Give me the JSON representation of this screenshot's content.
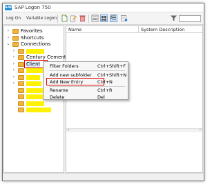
{
  "window": {
    "title": "SAP Logon 750"
  },
  "toolbar": {
    "logon_label": "Log On",
    "variable_logon_label": "Variable Logon",
    "icons": [
      "new-item-icon",
      "edit-icon",
      "delete-icon",
      "list-view-icon",
      "tile-view-icon",
      "tree-view-icon",
      "properties-icon",
      "filter-icon"
    ]
  },
  "tree": {
    "items": [
      {
        "label": "Favorites",
        "level": 0,
        "caret": "›"
      },
      {
        "label": "Shortcuts",
        "level": 0,
        "caret": "›"
      },
      {
        "label": "Connections",
        "level": 0,
        "caret": "⌄"
      },
      {
        "label": "",
        "level": 1,
        "caret": "›",
        "redacted": true
      },
      {
        "label": "Century Cement",
        "level": 1,
        "caret": "›"
      },
      {
        "label": "Client",
        "level": 1,
        "caret": "›",
        "selected": true
      },
      {
        "label": "",
        "level": 1,
        "caret": "›",
        "redacted": true
      },
      {
        "label": "",
        "level": 1,
        "caret": "›",
        "redacted": true
      },
      {
        "label": "",
        "level": 1,
        "caret": "›",
        "redacted": true
      },
      {
        "label": "",
        "level": 1,
        "caret": "",
        "redacted": true
      },
      {
        "label": "",
        "level": 1,
        "caret": "",
        "redacted": true
      },
      {
        "label": "",
        "level": 1,
        "caret": "",
        "redacted": true
      },
      {
        "label": "",
        "level": 1,
        "caret": "",
        "redacted": true
      }
    ]
  },
  "list": {
    "columns": [
      "Name",
      "System Description"
    ]
  },
  "context_menu": {
    "items": [
      {
        "label": "Filter Folders",
        "shortcut": "Ctrl+Shift+F"
      },
      {
        "label": "Add new subfolder",
        "shortcut": "Ctrl+Shift+N"
      },
      {
        "label": "Add New Entry",
        "shortcut": "Ctrl+N",
        "highlighted": true
      },
      {
        "label": "Rename",
        "shortcut": "Ctrl+R"
      },
      {
        "label": "Delete",
        "shortcut": "Del"
      }
    ]
  },
  "colors": {
    "annotation_red": "#e00000",
    "redaction_yellow": "#fff200",
    "folder": "#f0b33e",
    "app_icon": "#1f8ad8"
  }
}
